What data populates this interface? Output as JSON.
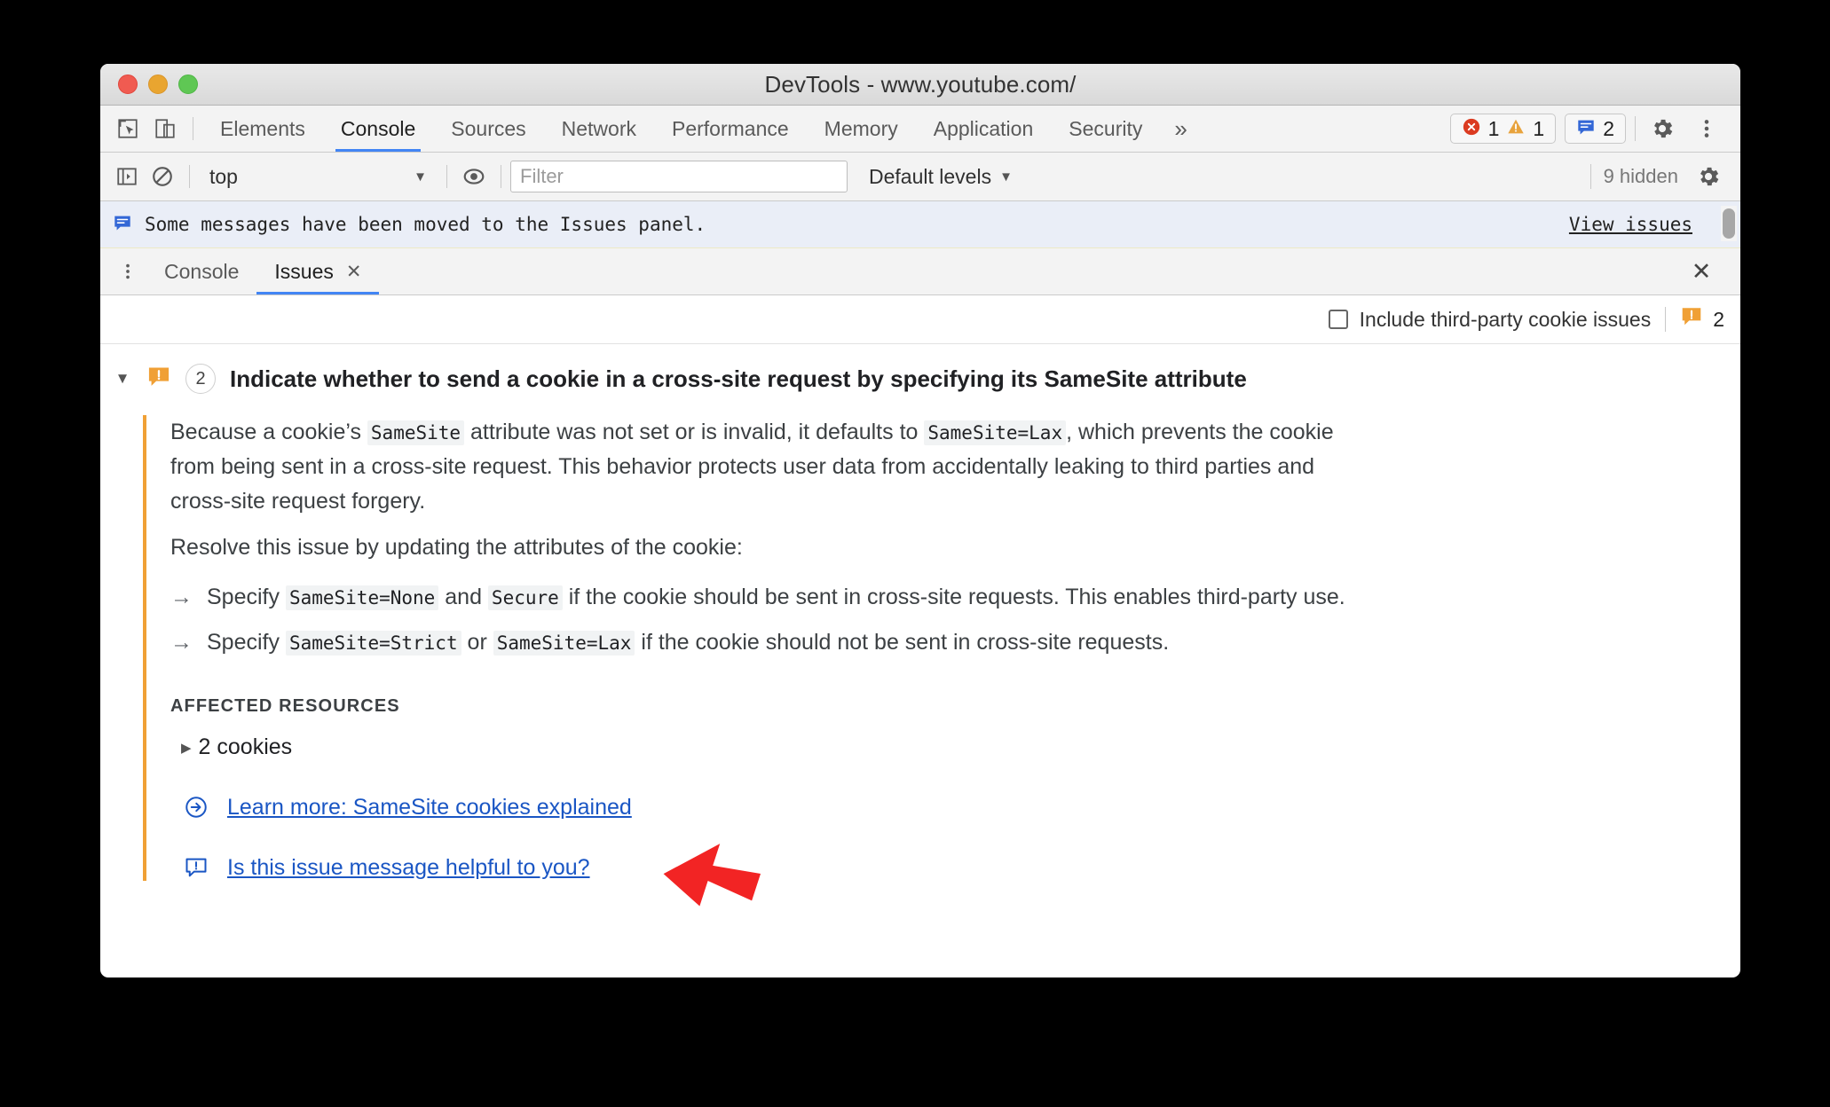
{
  "window": {
    "title": "DevTools - www.youtube.com/",
    "traffic_lights": [
      "close",
      "minimize",
      "maximize"
    ]
  },
  "main_tabs": {
    "items": [
      {
        "label": "Elements",
        "selected": false
      },
      {
        "label": "Console",
        "selected": true
      },
      {
        "label": "Sources",
        "selected": false
      },
      {
        "label": "Network",
        "selected": false
      },
      {
        "label": "Performance",
        "selected": false
      },
      {
        "label": "Memory",
        "selected": false
      },
      {
        "label": "Application",
        "selected": false
      },
      {
        "label": "Security",
        "selected": false
      }
    ],
    "more_label": "»",
    "error_count": "1",
    "warning_count": "1",
    "issue_count": "2"
  },
  "console_toolbar": {
    "context": "top",
    "context_arrow": "▼",
    "filter_placeholder": "Filter",
    "filter_value": "",
    "levels": "Default levels",
    "levels_arrow": "▼",
    "hidden": "9 hidden"
  },
  "console_message": {
    "text": "Some messages have been moved to the Issues panel.",
    "link": "View issues"
  },
  "drawer": {
    "tabs": [
      {
        "label": "Console",
        "selected": false,
        "closable": false
      },
      {
        "label": "Issues",
        "selected": true,
        "closable": true,
        "close_glyph": "✕"
      }
    ],
    "close_glyph": "✕"
  },
  "issues_toolbar": {
    "checkbox_label": "Include third-party cookie issues",
    "checkbox_checked": false,
    "count": "2"
  },
  "issue": {
    "caret": "▼",
    "count": "2",
    "title": "Indicate whether to send a cookie in a cross-site request by specifying its SameSite attribute",
    "paragraph1_a": "Because a cookie’s ",
    "paragraph1_code1": "SameSite",
    "paragraph1_b": " attribute was not set or is invalid, it defaults to ",
    "paragraph1_code2": "SameSite=Lax",
    "paragraph1_c": ", which prevents the cookie from being sent in a cross-site request. This behavior protects user data from accidentally leaking to third parties and cross-site request forgery.",
    "paragraph2": "Resolve this issue by updating the attributes of the cookie:",
    "bullet_arrow": "→",
    "bullet1_a": "Specify ",
    "bullet1_code1": "SameSite=None",
    "bullet1_b": " and ",
    "bullet1_code2": "Secure",
    "bullet1_c": " if the cookie should be sent in cross-site requests. This enables third-party use.",
    "bullet2_a": "Specify ",
    "bullet2_code1": "SameSite=Strict",
    "bullet2_b": " or ",
    "bullet2_code2": "SameSite=Lax",
    "bullet2_c": " if the cookie should not be sent in cross-site requests.",
    "affected_resources_label": "AFFECTED RESOURCES",
    "resource_caret": "▶",
    "resource_label": "2 cookies",
    "learn_more_link": "Learn more: SameSite cookies explained",
    "feedback_link": "Is this issue message helpful to you?"
  },
  "colors": {
    "accent_blue": "#4285f4",
    "link_blue": "#1a56c4",
    "issue_orange": "#f0a035",
    "error_red": "#db3b21",
    "warning_yellow": "#e8a33d",
    "pointer_red": "#f22424"
  }
}
